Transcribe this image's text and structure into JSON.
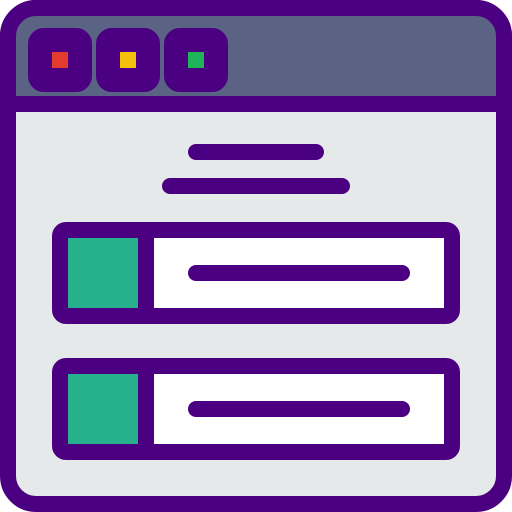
{
  "icon": {
    "name": "browser-window-list-icon",
    "colors": {
      "outline": "#4b0082",
      "titlebar": "#5a6384",
      "content_bg": "#e6e9ea",
      "card_bg": "#ffffff",
      "card_accent": "#26b08c",
      "dot_red": "#e33b2e",
      "dot_yellow": "#f4c20d",
      "dot_green": "#1fb35a"
    }
  }
}
